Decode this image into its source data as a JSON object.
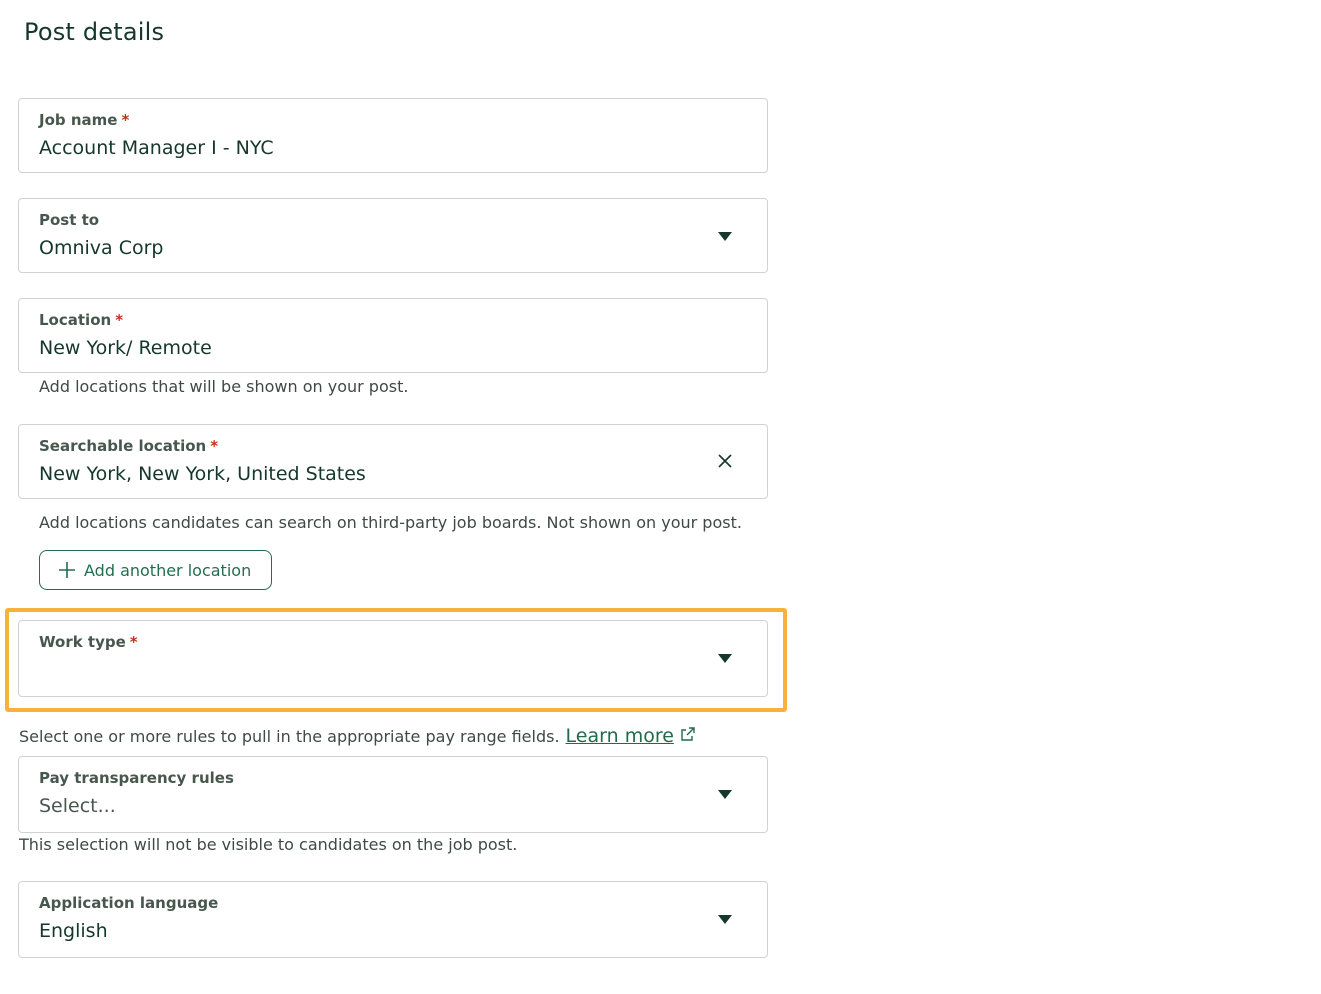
{
  "page": {
    "title": "Post details"
  },
  "required_marker": "*",
  "fields": {
    "job_name": {
      "label": "Job name",
      "value": "Account Manager I - NYC"
    },
    "post_to": {
      "label": "Post to",
      "value": "Omniva Corp"
    },
    "location": {
      "label": "Location",
      "value": "New York/ Remote",
      "help": "Add locations that will be shown on your post."
    },
    "searchable_location": {
      "label": "Searchable location",
      "value": "New York, New York, United States",
      "help": "Add locations candidates can search on third-party job boards. Not shown on your post."
    },
    "work_type": {
      "label": "Work type",
      "value": ""
    },
    "pay_transparency": {
      "intro": "Select one or more rules to pull in the appropriate pay range fields.",
      "learn_more": "Learn more",
      "label": "Pay transparency rules",
      "placeholder": "Select...",
      "help": "This selection will not be visible to candidates on the job post."
    },
    "application_language": {
      "label": "Application language",
      "value": "English"
    }
  },
  "buttons": {
    "add_location": "Add another location"
  },
  "icons": {
    "dropdown": "caret-down-icon",
    "clear": "close-icon",
    "add": "plus-icon",
    "external": "external-link-icon"
  },
  "colors": {
    "highlight": "#f8b13a",
    "accent": "#236e4f",
    "required": "#c4301c"
  }
}
